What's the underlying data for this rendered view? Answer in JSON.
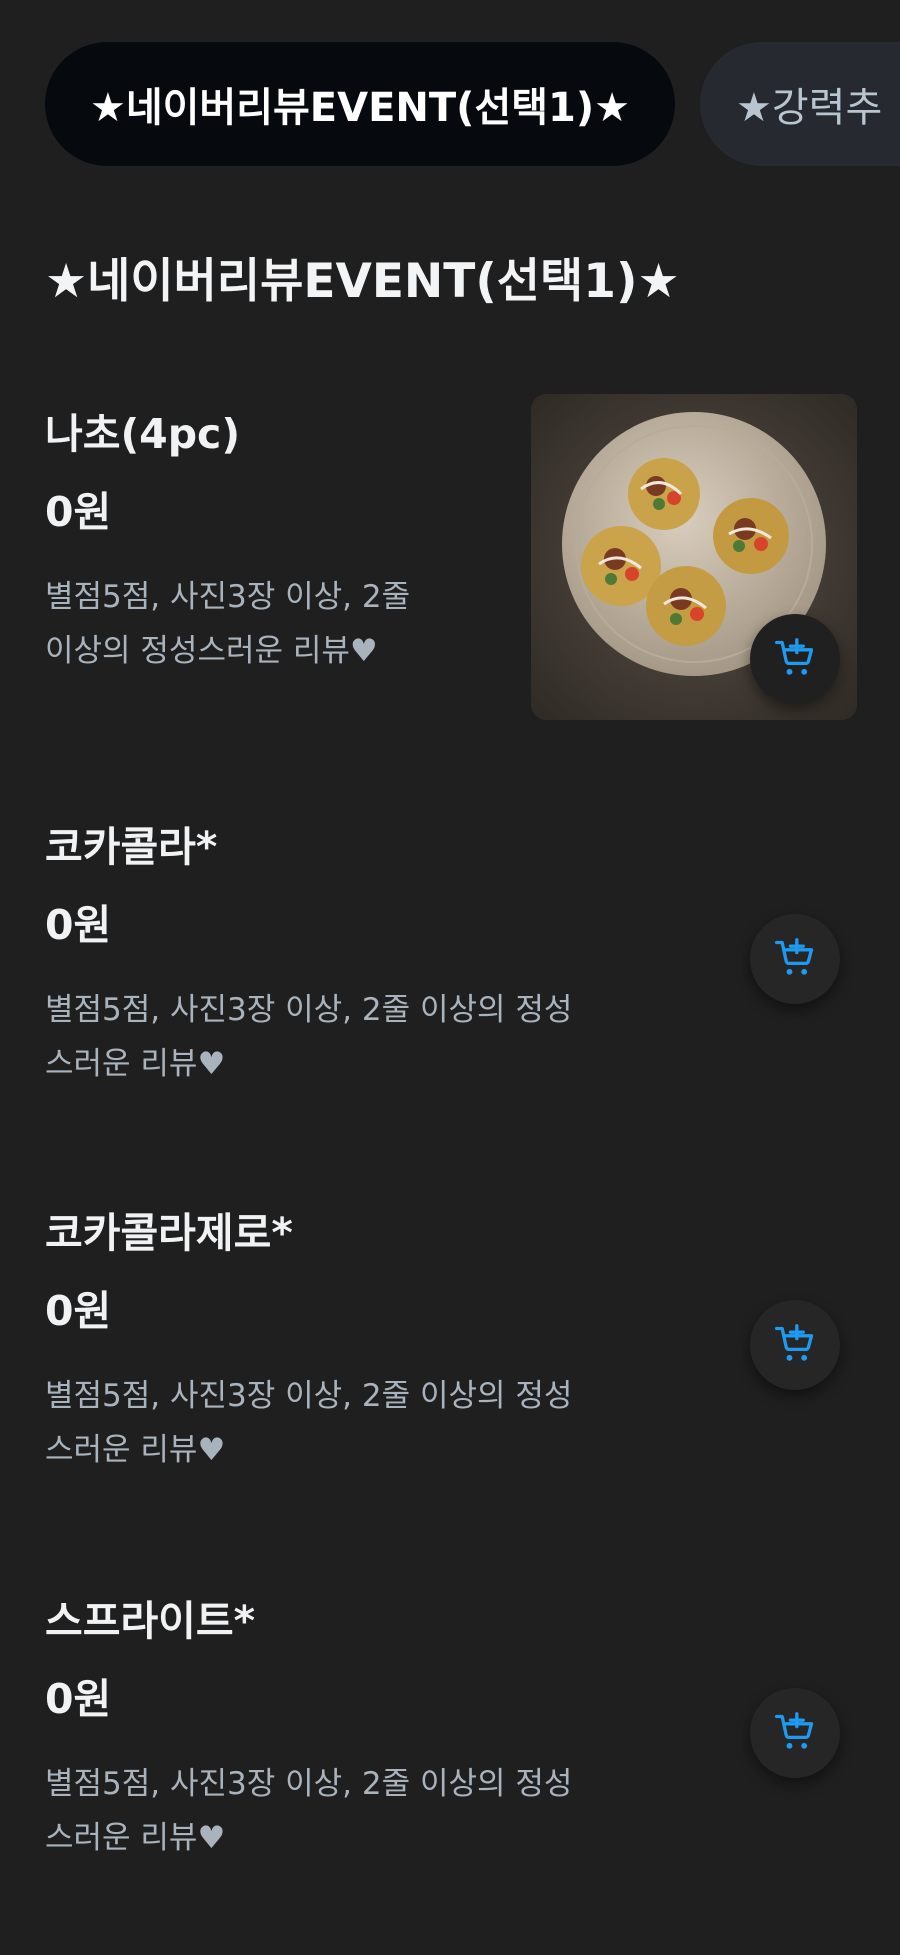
{
  "tabs": [
    {
      "label": "★네이버리뷰EVENT(선택1)★",
      "active": true
    },
    {
      "label": "★강력추",
      "active": false
    }
  ],
  "section": {
    "title": "★네이버리뷰EVENT(선택1)★"
  },
  "items": [
    {
      "name": "나초(4pc)",
      "price": "0원",
      "desc_line1": "별점5점, 사진3장 이상, 2줄",
      "desc_line2": "이상의 정성스러운 리뷰♥",
      "has_photo": true
    },
    {
      "name": "코카콜라*",
      "price": "0원",
      "desc_line1": "별점5점, 사진3장 이상, 2줄 이상의 정성",
      "desc_line2": "스러운 리뷰♥",
      "has_photo": false
    },
    {
      "name": "코카콜라제로*",
      "price": "0원",
      "desc_line1": "별점5점, 사진3장 이상, 2줄 이상의 정성",
      "desc_line2": "스러운 리뷰♥",
      "has_photo": false
    },
    {
      "name": "스프라이트*",
      "price": "0원",
      "desc_line1": "별점5점, 사진3장 이상, 2줄 이상의 정성",
      "desc_line2": "스러운 리뷰♥",
      "has_photo": false
    }
  ],
  "icons": {
    "cart": "add-to-cart-icon"
  },
  "colors": {
    "accent": "#1e9bf0",
    "background": "#1f1f1f",
    "tab_active": "#060a0f"
  }
}
